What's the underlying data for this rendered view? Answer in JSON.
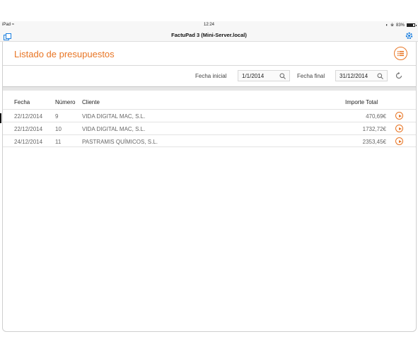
{
  "status_bar": {
    "device": "iPad",
    "time": "12:24",
    "battery": "83%",
    "battery_level": 0.83
  },
  "title_bar": {
    "title": "FactuPad 3 (Mini-Server.local)",
    "left_icon": "copy-icon",
    "right_icon": "gear-icon"
  },
  "page": {
    "title": "Listado de presupuestos",
    "menu_icon": "list-menu-icon"
  },
  "filters": {
    "start_label": "Fecha inicial",
    "start_value": "1/1/2014",
    "end_label": "Fecha final",
    "end_value": "31/12/2014",
    "refresh_icon": "refresh-icon"
  },
  "table": {
    "headers": {
      "date": "Fecha",
      "number": "Número",
      "client": "Cliente",
      "total": "Importe Total"
    },
    "rows": [
      {
        "date": "22/12/2014",
        "number": "9",
        "client": "VIDA DIGITAL MAC, S.L.",
        "total": "470,69€"
      },
      {
        "date": "22/12/2014",
        "number": "10",
        "client": "VIDA DIGITAL MAC, S.L.",
        "total": "1732,72€"
      },
      {
        "date": "24/12/2014",
        "number": "11",
        "client": "PASTRAMIS QUÍMICOS, S.L.",
        "total": "2353,45€"
      }
    ]
  },
  "colors": {
    "accent": "#e87524",
    "ios_blue": "#1a7fe0"
  }
}
